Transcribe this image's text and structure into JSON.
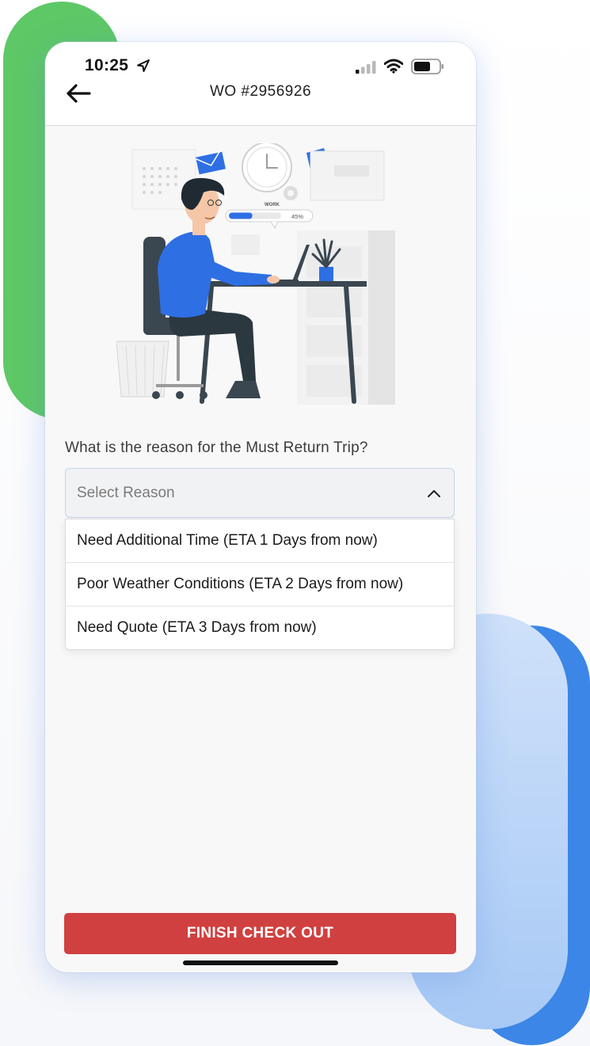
{
  "status_bar": {
    "time": "10:25",
    "icons": [
      "location-arrow-icon",
      "cellular-signal-icon",
      "wifi-icon",
      "battery-icon"
    ]
  },
  "header": {
    "back_icon": "arrow-left-icon",
    "title": "WO #2956926"
  },
  "illustration": {
    "label": "WORK",
    "progress_text": "45%",
    "progress": 0.45
  },
  "form": {
    "question": "What is the reason for the Must Return Trip?",
    "select": {
      "placeholder": "Select Reason",
      "expanded": true,
      "options": [
        "Need Additional Time (ETA 1 Days from now)",
        "Poor Weather Conditions (ETA 2 Days from now)",
        "Need Quote (ETA 3 Days from now)"
      ]
    }
  },
  "footer": {
    "finish_label": "FINISH CHECK OUT"
  },
  "colors": {
    "primary_button": "#d04040",
    "illustration_blue": "#2f6fe4",
    "deco_green": "#5ec866",
    "deco_blue": "#3b86e6"
  }
}
